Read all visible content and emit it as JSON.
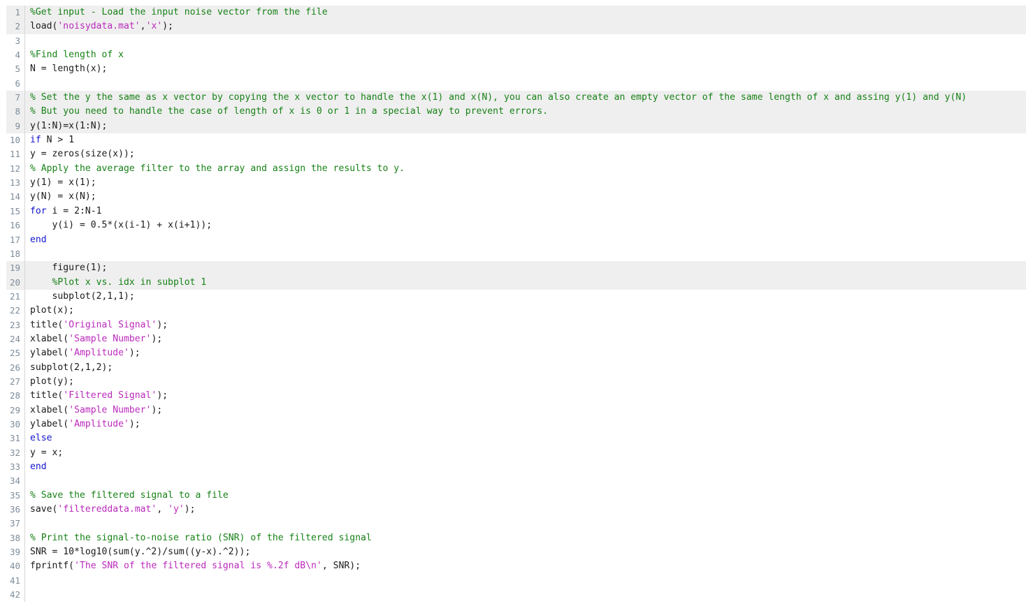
{
  "editor": {
    "language": "MATLAB",
    "colors": {
      "background": "#ffffff",
      "shaded_row": "#efefef",
      "gutter_text": "#7d8c9a",
      "gutter_rule": "#d6d6d6",
      "comment": "#178117",
      "string": "#bb29bb",
      "keyword": "#1414cf",
      "plain_text": "#1a1a1a"
    },
    "first_visible_line": 1,
    "last_visible_line": 42,
    "lines": [
      {
        "number": "1",
        "shaded": true,
        "tokens": [
          {
            "type": "comment",
            "text": "%Get input - Load the input noise vector from the file"
          }
        ]
      },
      {
        "number": "2",
        "shaded": true,
        "tokens": [
          {
            "type": "plain",
            "text": "load("
          },
          {
            "type": "string",
            "text": "'noisydata.mat'"
          },
          {
            "type": "plain",
            "text": ","
          },
          {
            "type": "string",
            "text": "'x'"
          },
          {
            "type": "plain",
            "text": ");"
          }
        ]
      },
      {
        "number": "3",
        "shaded": false,
        "tokens": []
      },
      {
        "number": "4",
        "shaded": false,
        "tokens": [
          {
            "type": "comment",
            "text": "%Find length of x"
          }
        ]
      },
      {
        "number": "5",
        "shaded": false,
        "tokens": [
          {
            "type": "plain",
            "text": "N = length(x);"
          }
        ]
      },
      {
        "number": "6",
        "shaded": false,
        "tokens": []
      },
      {
        "number": "7",
        "shaded": true,
        "tokens": [
          {
            "type": "comment",
            "text": "% Set the y the same as x vector by copying the x vector to handle the x(1) and x(N), you can also create an empty vector of the same length of x and assing y(1) and y(N)"
          }
        ]
      },
      {
        "number": "8",
        "shaded": true,
        "tokens": [
          {
            "type": "comment",
            "text": "% But you need to handle the case of length of x is 0 or 1 in a special way to prevent errors."
          }
        ]
      },
      {
        "number": "9",
        "shaded": true,
        "tokens": [
          {
            "type": "plain",
            "text": "y(1:N)=x(1:N);"
          }
        ]
      },
      {
        "number": "10",
        "shaded": false,
        "tokens": [
          {
            "type": "keyword",
            "text": "if"
          },
          {
            "type": "plain",
            "text": " N > 1"
          }
        ]
      },
      {
        "number": "11",
        "shaded": false,
        "tokens": [
          {
            "type": "plain",
            "text": "y = zeros(size(x));"
          }
        ]
      },
      {
        "number": "12",
        "shaded": false,
        "tokens": [
          {
            "type": "comment",
            "text": "% Apply the average filter to the array and assign the results to y."
          }
        ]
      },
      {
        "number": "13",
        "shaded": false,
        "tokens": [
          {
            "type": "plain",
            "text": "y(1) = x(1);"
          }
        ]
      },
      {
        "number": "14",
        "shaded": false,
        "tokens": [
          {
            "type": "plain",
            "text": "y(N) = x(N);"
          }
        ]
      },
      {
        "number": "15",
        "shaded": false,
        "tokens": [
          {
            "type": "keyword",
            "text": "for"
          },
          {
            "type": "plain",
            "text": " i = 2:N-1"
          }
        ]
      },
      {
        "number": "16",
        "shaded": false,
        "tokens": [
          {
            "type": "plain",
            "text": "    y(i) = 0.5*(x(i-1) + x(i+1));"
          }
        ]
      },
      {
        "number": "17",
        "shaded": false,
        "tokens": [
          {
            "type": "keyword",
            "text": "end"
          }
        ]
      },
      {
        "number": "18",
        "shaded": false,
        "tokens": []
      },
      {
        "number": "19",
        "shaded": true,
        "tokens": [
          {
            "type": "plain",
            "text": "    figure(1);"
          }
        ]
      },
      {
        "number": "20",
        "shaded": true,
        "tokens": [
          {
            "type": "plain",
            "text": "    "
          },
          {
            "type": "comment",
            "text": "%Plot x vs. idx in subplot 1"
          }
        ]
      },
      {
        "number": "21",
        "shaded": false,
        "tokens": [
          {
            "type": "plain",
            "text": "    subplot(2,1,1);"
          }
        ]
      },
      {
        "number": "22",
        "shaded": false,
        "tokens": [
          {
            "type": "plain",
            "text": "plot(x);"
          }
        ]
      },
      {
        "number": "23",
        "shaded": false,
        "tokens": [
          {
            "type": "plain",
            "text": "title("
          },
          {
            "type": "string",
            "text": "'Original Signal'"
          },
          {
            "type": "plain",
            "text": ");"
          }
        ]
      },
      {
        "number": "24",
        "shaded": false,
        "tokens": [
          {
            "type": "plain",
            "text": "xlabel("
          },
          {
            "type": "string",
            "text": "'Sample Number'"
          },
          {
            "type": "plain",
            "text": ");"
          }
        ]
      },
      {
        "number": "25",
        "shaded": false,
        "tokens": [
          {
            "type": "plain",
            "text": "ylabel("
          },
          {
            "type": "string",
            "text": "'Amplitude'"
          },
          {
            "type": "plain",
            "text": ");"
          }
        ]
      },
      {
        "number": "26",
        "shaded": false,
        "tokens": [
          {
            "type": "plain",
            "text": "subplot(2,1,2);"
          }
        ]
      },
      {
        "number": "27",
        "shaded": false,
        "tokens": [
          {
            "type": "plain",
            "text": "plot(y);"
          }
        ]
      },
      {
        "number": "28",
        "shaded": false,
        "tokens": [
          {
            "type": "plain",
            "text": "title("
          },
          {
            "type": "string",
            "text": "'Filtered Signal'"
          },
          {
            "type": "plain",
            "text": ");"
          }
        ]
      },
      {
        "number": "29",
        "shaded": false,
        "tokens": [
          {
            "type": "plain",
            "text": "xlabel("
          },
          {
            "type": "string",
            "text": "'Sample Number'"
          },
          {
            "type": "plain",
            "text": ");"
          }
        ]
      },
      {
        "number": "30",
        "shaded": false,
        "tokens": [
          {
            "type": "plain",
            "text": "ylabel("
          },
          {
            "type": "string",
            "text": "'Amplitude'"
          },
          {
            "type": "plain",
            "text": ");"
          }
        ]
      },
      {
        "number": "31",
        "shaded": false,
        "tokens": [
          {
            "type": "keyword",
            "text": "else"
          }
        ]
      },
      {
        "number": "32",
        "shaded": false,
        "tokens": [
          {
            "type": "plain",
            "text": "y = x;"
          }
        ]
      },
      {
        "number": "33",
        "shaded": false,
        "tokens": [
          {
            "type": "keyword",
            "text": "end"
          }
        ]
      },
      {
        "number": "34",
        "shaded": false,
        "tokens": []
      },
      {
        "number": "35",
        "shaded": false,
        "tokens": [
          {
            "type": "comment",
            "text": "% Save the filtered signal to a file"
          }
        ]
      },
      {
        "number": "36",
        "shaded": false,
        "tokens": [
          {
            "type": "plain",
            "text": "save("
          },
          {
            "type": "string",
            "text": "'filtereddata.mat'"
          },
          {
            "type": "plain",
            "text": ", "
          },
          {
            "type": "string",
            "text": "'y'"
          },
          {
            "type": "plain",
            "text": ");"
          }
        ]
      },
      {
        "number": "37",
        "shaded": false,
        "tokens": []
      },
      {
        "number": "38",
        "shaded": false,
        "tokens": [
          {
            "type": "comment",
            "text": "% Print the signal-to-noise ratio (SNR) of the filtered signal"
          }
        ]
      },
      {
        "number": "39",
        "shaded": false,
        "tokens": [
          {
            "type": "plain",
            "text": "SNR = 10*log10(sum(y.^2)/sum((y-x).^2));"
          }
        ]
      },
      {
        "number": "40",
        "shaded": false,
        "tokens": [
          {
            "type": "plain",
            "text": "fprintf("
          },
          {
            "type": "string",
            "text": "'The SNR of the filtered signal is %.2f dB\\n'"
          },
          {
            "type": "plain",
            "text": ", SNR);"
          }
        ]
      },
      {
        "number": "41",
        "shaded": false,
        "tokens": []
      },
      {
        "number": "42",
        "shaded": false,
        "tokens": []
      }
    ]
  }
}
